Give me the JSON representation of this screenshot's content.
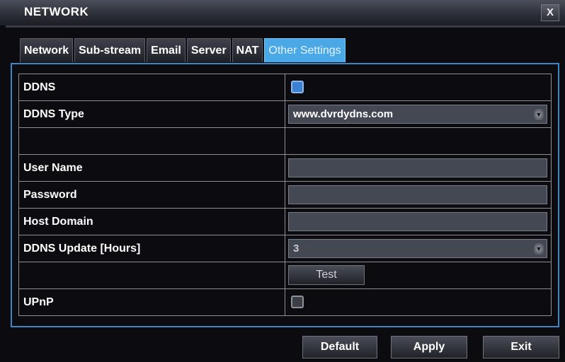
{
  "window": {
    "title": "NETWORK",
    "close_label": "X"
  },
  "tabs": [
    {
      "label": "Network",
      "active": false
    },
    {
      "label": "Sub-stream",
      "active": false
    },
    {
      "label": "Email",
      "active": false
    },
    {
      "label": "Server",
      "active": false
    },
    {
      "label": "NAT",
      "active": false
    },
    {
      "label": "Other Settings",
      "active": true
    }
  ],
  "form": {
    "ddns": {
      "label": "DDNS",
      "checked": true
    },
    "ddns_type": {
      "label": "DDNS Type",
      "value": "www.dvrdydns.com"
    },
    "user_name": {
      "label": "User Name",
      "value": ""
    },
    "password": {
      "label": "Password",
      "value": ""
    },
    "host_domain": {
      "label": "Host Domain",
      "value": ""
    },
    "ddns_update": {
      "label": "DDNS Update [Hours]",
      "value": "3"
    },
    "test_label": "Test",
    "upnp": {
      "label": "UPnP",
      "checked": false
    }
  },
  "footer": {
    "default_label": "Default",
    "apply_label": "Apply",
    "exit_label": "Exit"
  },
  "colors": {
    "accent": "#4aa8e6",
    "panel_border": "#3d87c4",
    "checkbox_on": "#3d7fd3"
  }
}
